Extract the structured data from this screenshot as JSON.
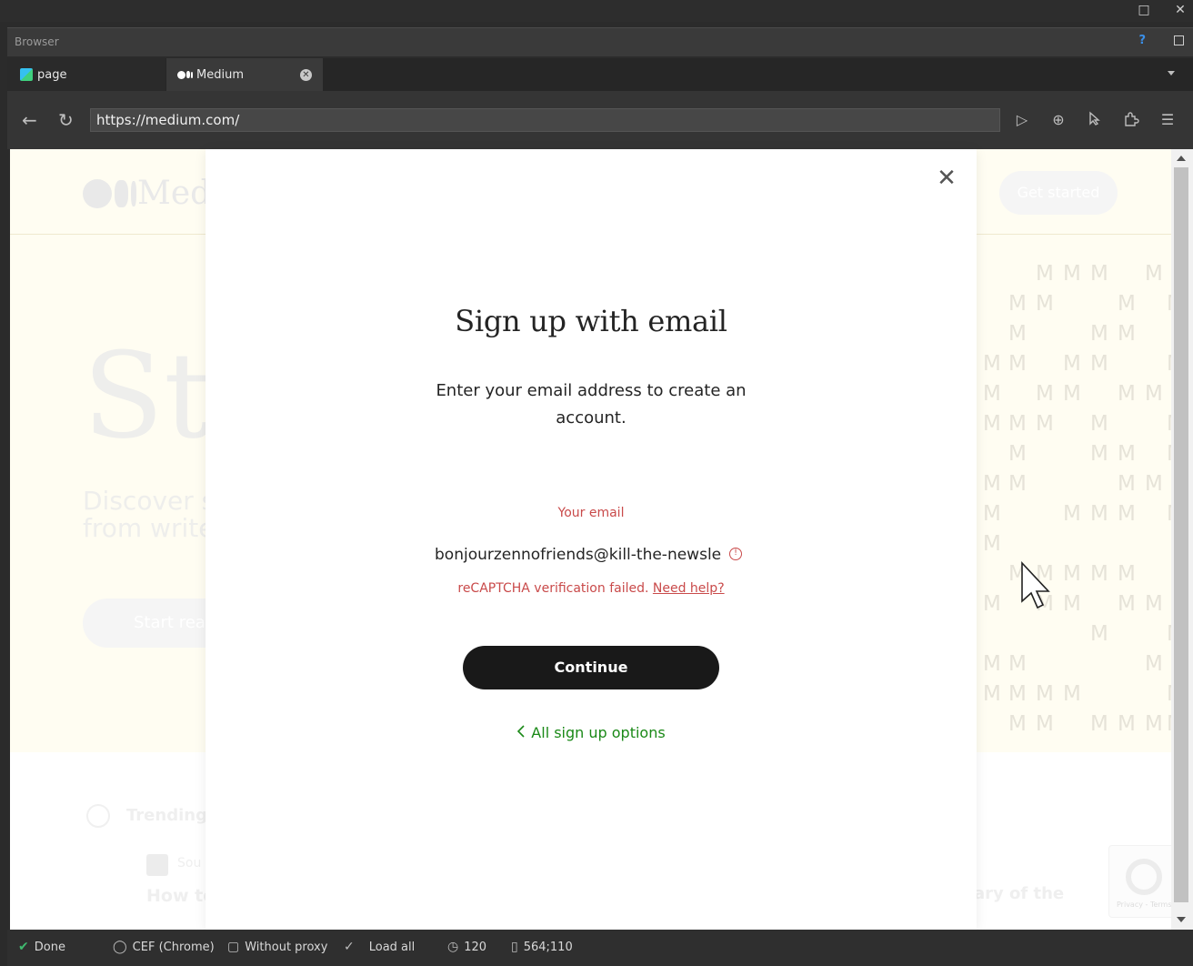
{
  "window": {
    "title": "Browser",
    "help": "?"
  },
  "tabs": [
    {
      "label": "page",
      "active": false
    },
    {
      "label": "Medium",
      "active": true
    }
  ],
  "address_bar": {
    "url": "https://medium.com/"
  },
  "background_page": {
    "logo_text": "Medium",
    "get_started": "Get started",
    "hero_heading_fragment": "Sta",
    "hero_sub_line1": "Discover s",
    "hero_sub_line2": "from write",
    "start_button": "Start rea",
    "m_letter": "M",
    "trending_label": "Trending",
    "trending_author_fragment": "Sou",
    "trending_title_fragment": "How to",
    "trending_right_fragment": "ary of the",
    "recaptcha_text": "Privacy - Terms"
  },
  "modal": {
    "title": "Sign up with email",
    "subtitle": "Enter your email address to create an account.",
    "email_label": "Your email",
    "email_value": "bonjourzennofriends@kill-the-newsle",
    "error_text": "reCAPTCHA verification failed.",
    "error_link": "Need help?",
    "continue_label": "Continue",
    "back_label": "All sign up options"
  },
  "status_bar": {
    "state": "Done",
    "engine": "CEF (Chrome)",
    "proxy": "Without proxy",
    "load": "Load all",
    "timeout": "120",
    "mouse": "564;110"
  },
  "colors": {
    "accent_green": "#1a8917",
    "error_red": "#c94a4a",
    "button_dark": "#191919",
    "hero_bg": "#fffdf2"
  }
}
